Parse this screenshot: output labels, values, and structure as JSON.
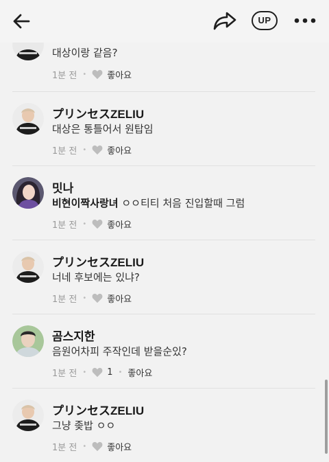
{
  "header": {
    "up_label": "UP",
    "icons": [
      "back-arrow-icon",
      "share-icon",
      "more-icon"
    ]
  },
  "comments": [
    {
      "name": "",
      "mention": "",
      "text": "대상이랑 같음?",
      "time": "1분 전",
      "like_label": "좋아요",
      "like_count": ""
    },
    {
      "name": "プリンセスZELIU",
      "mention": "",
      "text": "대상은 통틀어서 원탑임",
      "time": "1분 전",
      "like_label": "좋아요",
      "like_count": ""
    },
    {
      "name": "밋나",
      "mention": "비현이짝사랑녀",
      "text": " ㅇㅇ티티 처음 진입할때 그럼",
      "time": "1분 전",
      "like_label": "좋아요",
      "like_count": ""
    },
    {
      "name": "プリンセスZELIU",
      "mention": "",
      "text": "너네 후보에는 있냐?",
      "time": "1분 전",
      "like_label": "좋아요",
      "like_count": ""
    },
    {
      "name": "곰스지한",
      "mention": "",
      "text": "음원어차피 주작인데 받을순있?",
      "time": "1분 전",
      "like_label": "좋아요",
      "like_count": "1"
    },
    {
      "name": "プリンセスZELIU",
      "mention": "",
      "text": "그냥 좆밥 ㅇㅇ",
      "time": "1분 전",
      "like_label": "좋아요",
      "like_count": ""
    }
  ],
  "colors": {
    "background": "#f2f2f2",
    "meta_text": "#9a9a9a",
    "heart": "#bdbdbd"
  }
}
